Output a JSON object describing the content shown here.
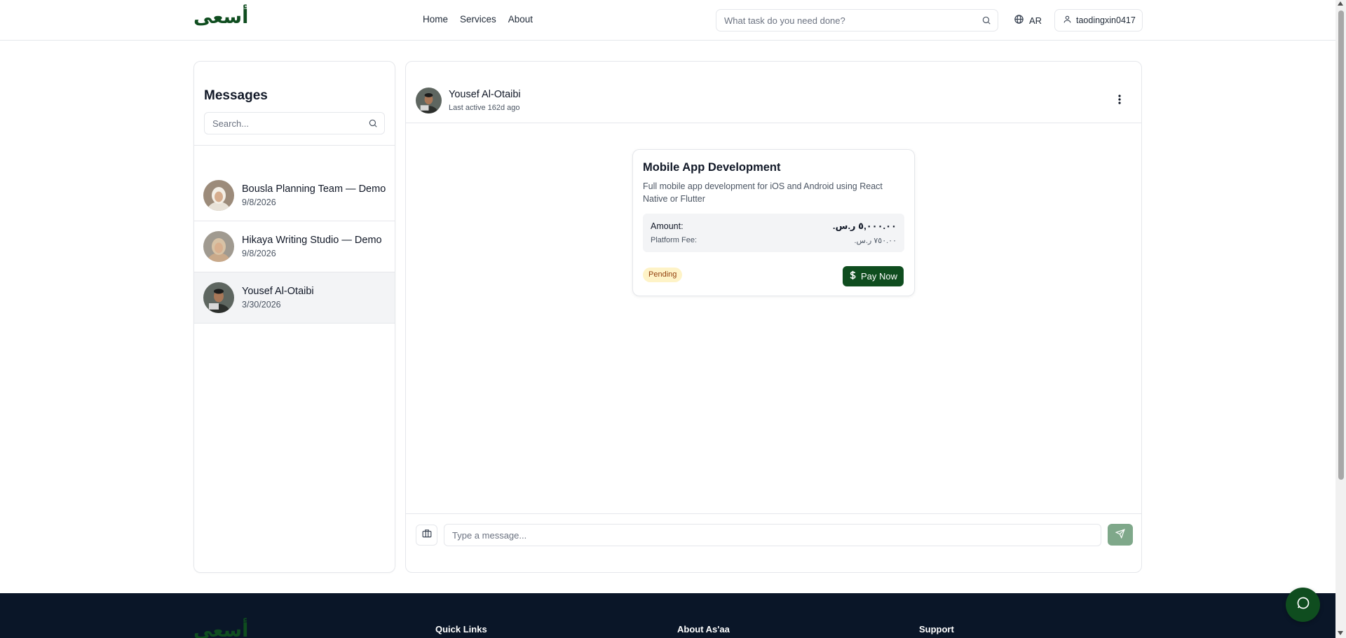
{
  "header": {
    "logo": "أسعى",
    "nav": [
      {
        "label": "Home"
      },
      {
        "label": "Services"
      },
      {
        "label": "About"
      }
    ],
    "search_placeholder": "What task do you need done?",
    "language": "AR",
    "username": "taodingxin0417"
  },
  "sidebar": {
    "title": "Messages",
    "search_placeholder": "Search...",
    "conversations": [
      {
        "name": "Bousla Planning Team — Demo",
        "date": "9/8/2026",
        "active": false
      },
      {
        "name": "Hikaya Writing Studio — Demo",
        "date": "9/8/2026",
        "active": false
      },
      {
        "name": "Yousef Al-Otaibi",
        "date": "3/30/2026",
        "active": true
      }
    ]
  },
  "chat": {
    "contact_name": "Yousef Al-Otaibi",
    "status": "Last active 162d ago",
    "offer": {
      "title": "Mobile App Development",
      "description": "Full mobile app development for iOS and Android using React Native or Flutter",
      "amount_label": "Amount:",
      "amount_value": "٥,٠٠٠.٠٠ ر.س.",
      "fee_label": "Platform Fee:",
      "fee_value": "٧٥٠.٠٠ ر.س.",
      "status": "Pending",
      "pay_label": "Pay Now"
    },
    "message_placeholder": "Type a message..."
  },
  "footer": {
    "logo": "أسعى",
    "columns": [
      "Quick Links",
      "About As'aa",
      "Support"
    ]
  },
  "colors": {
    "brand": "#0f4d1f",
    "footer_bg": "#0a1628",
    "pending_bg": "#fef3c7",
    "send_disabled": "#7fa88a"
  },
  "icons": [
    "search-icon",
    "globe-icon",
    "user-icon",
    "kebab-menu-icon",
    "dollar-icon",
    "briefcase-icon",
    "send-icon",
    "chat-bubble-icon"
  ]
}
